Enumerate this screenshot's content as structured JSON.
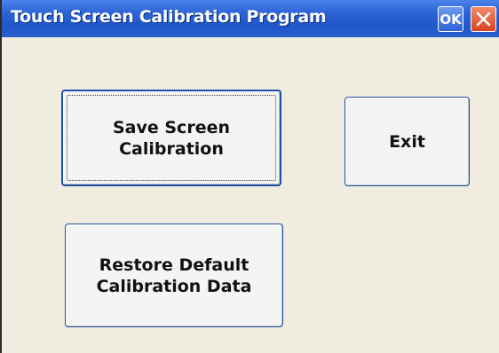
{
  "window": {
    "title": "Touch Screen Calibration Program",
    "ok_label": "OK",
    "close_symbol": "×"
  },
  "buttons": {
    "save_label": "Save Screen\nCalibration",
    "exit_label": "Exit",
    "restore_label": "Restore Default\nCalibration Data"
  },
  "icons": {
    "close": "close-icon"
  },
  "colors": {
    "titlebar": "#2c63d6",
    "close_button": "#d9431e",
    "client_background": "#f0ece0",
    "button_border": "#1e4fa8"
  }
}
